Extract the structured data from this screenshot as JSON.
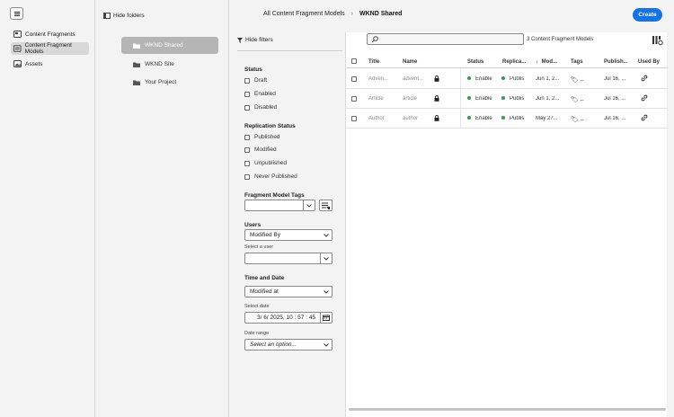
{
  "nav": {
    "items": [
      {
        "label": "Content Fragments",
        "icon": "content-fragments-icon"
      },
      {
        "label": "Content Fragment Models",
        "icon": "fragment-models-icon"
      },
      {
        "label": "Assets",
        "icon": "assets-icon"
      }
    ]
  },
  "folders": {
    "hide_label": "Hide folders",
    "items": [
      {
        "label": "WKND Shared"
      },
      {
        "label": "WKND Site"
      },
      {
        "label": "Your Project"
      }
    ]
  },
  "header": {
    "breadcrumb_parent": "All Content Fragment Models",
    "breadcrumb_separator": "›",
    "breadcrumb_current": "WKND Shared",
    "create_label": "Create"
  },
  "filters": {
    "hide_label": "Hide filters",
    "status": {
      "title": "Status",
      "options": [
        "Draft",
        "Enabled",
        "Disabled"
      ]
    },
    "replication": {
      "title": "Replication Status",
      "options": [
        "Published",
        "Modified",
        "Unpublished",
        "Never Published"
      ]
    },
    "tags": {
      "title": "Fragment Model Tags",
      "value": ""
    },
    "users": {
      "title": "Users",
      "selected": "Modified By",
      "select_label": "Select a user",
      "user_value": ""
    },
    "time": {
      "title": "Time and Date",
      "selected": "Modified at",
      "date_label": "Select date",
      "date_value": "3/ 6/ 2025, 10 : 57 : 45",
      "range_label": "Date range",
      "range_placeholder": "Select an option..."
    }
  },
  "table": {
    "search_placeholder": "",
    "count_label": "3 Content Fragment Models",
    "columns": [
      "Title",
      "Name",
      "Status",
      "Replica...",
      "Mod...",
      "Tags",
      "Publish...",
      "Used By"
    ],
    "rows": [
      {
        "title": "Adven...",
        "name": "advent...",
        "status": "Enable",
        "replication": "Publis",
        "modified": "Jun 1, 2...",
        "tags": "--",
        "published": "Jul 16, ..."
      },
      {
        "title": "Article",
        "name": "article",
        "status": "Enable",
        "replication": "Publis",
        "modified": "Jun 1, 2...",
        "tags": "--",
        "published": "Jul 16, ..."
      },
      {
        "title": "Author",
        "name": "author",
        "status": "Enable",
        "replication": "Publis",
        "modified": "May 27...",
        "tags": "--",
        "published": "Jul 16, ..."
      }
    ]
  },
  "colors": {
    "accent": "#1473e6",
    "status_green": "#2d9d4a",
    "selected_folder": "#b5b5b5"
  }
}
